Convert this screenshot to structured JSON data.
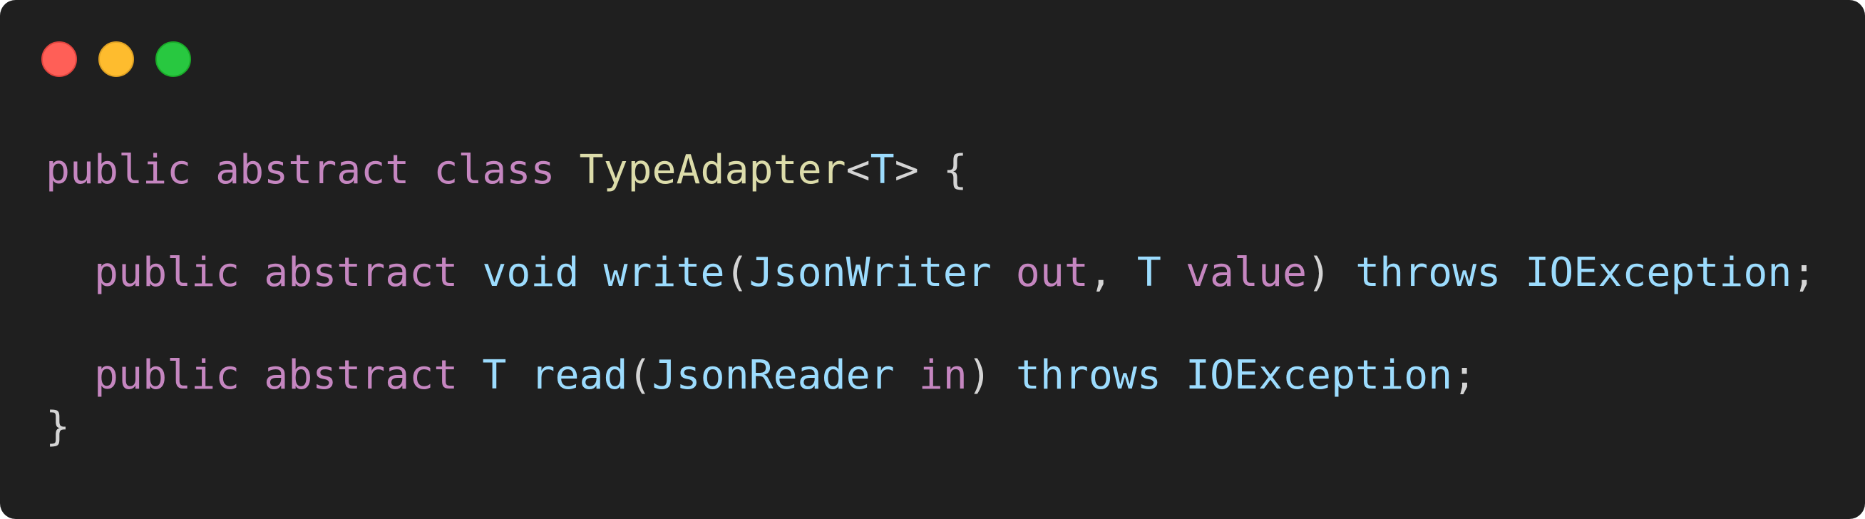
{
  "window": {
    "background": "#1f1f1f",
    "controls": [
      {
        "name": "close",
        "color": "#ff5f57",
        "border": "#e0443e"
      },
      {
        "name": "minimize",
        "color": "#febc2e",
        "border": "#dea123"
      },
      {
        "name": "maximize",
        "color": "#28c840",
        "border": "#1aab29"
      }
    ]
  },
  "colors": {
    "keyword": "#c586c0",
    "class_name": "#dcdcaa",
    "type": "#9cdcfe",
    "punctuation": "#d4d4d4"
  },
  "code": {
    "language": "java",
    "lines": [
      {
        "tokens": [
          {
            "t": "public",
            "k": "kw"
          },
          {
            "t": " ",
            "k": "punc"
          },
          {
            "t": "abstract",
            "k": "kw"
          },
          {
            "t": " ",
            "k": "punc"
          },
          {
            "t": "class",
            "k": "kw"
          },
          {
            "t": " ",
            "k": "punc"
          },
          {
            "t": "TypeAdapter",
            "k": "cls"
          },
          {
            "t": "<",
            "k": "punc"
          },
          {
            "t": "T",
            "k": "type"
          },
          {
            "t": ">",
            "k": "punc"
          },
          {
            "t": " {",
            "k": "punc"
          }
        ]
      },
      {
        "tokens": []
      },
      {
        "tokens": [
          {
            "t": "  ",
            "k": "punc"
          },
          {
            "t": "public",
            "k": "kw"
          },
          {
            "t": " ",
            "k": "punc"
          },
          {
            "t": "abstract",
            "k": "kw"
          },
          {
            "t": " ",
            "k": "punc"
          },
          {
            "t": "void",
            "k": "type"
          },
          {
            "t": " ",
            "k": "punc"
          },
          {
            "t": "write",
            "k": "fn"
          },
          {
            "t": "(",
            "k": "punc"
          },
          {
            "t": "JsonWriter",
            "k": "type"
          },
          {
            "t": " ",
            "k": "punc"
          },
          {
            "t": "out",
            "k": "param"
          },
          {
            "t": ", ",
            "k": "punc"
          },
          {
            "t": "T",
            "k": "type"
          },
          {
            "t": " ",
            "k": "punc"
          },
          {
            "t": "value",
            "k": "param"
          },
          {
            "t": ") ",
            "k": "punc"
          },
          {
            "t": "throws",
            "k": "type"
          },
          {
            "t": " ",
            "k": "punc"
          },
          {
            "t": "IOException",
            "k": "type"
          },
          {
            "t": ";",
            "k": "punc"
          }
        ]
      },
      {
        "tokens": []
      },
      {
        "tokens": [
          {
            "t": "  ",
            "k": "punc"
          },
          {
            "t": "public",
            "k": "kw"
          },
          {
            "t": " ",
            "k": "punc"
          },
          {
            "t": "abstract",
            "k": "kw"
          },
          {
            "t": " ",
            "k": "punc"
          },
          {
            "t": "T",
            "k": "type"
          },
          {
            "t": " ",
            "k": "punc"
          },
          {
            "t": "read",
            "k": "fn"
          },
          {
            "t": "(",
            "k": "punc"
          },
          {
            "t": "JsonReader",
            "k": "type"
          },
          {
            "t": " ",
            "k": "punc"
          },
          {
            "t": "in",
            "k": "param"
          },
          {
            "t": ") ",
            "k": "punc"
          },
          {
            "t": "throws",
            "k": "type"
          },
          {
            "t": " ",
            "k": "punc"
          },
          {
            "t": "IOException",
            "k": "type"
          },
          {
            "t": ";",
            "k": "punc"
          }
        ]
      },
      {
        "tokens": [
          {
            "t": "}",
            "k": "punc"
          }
        ]
      }
    ]
  }
}
